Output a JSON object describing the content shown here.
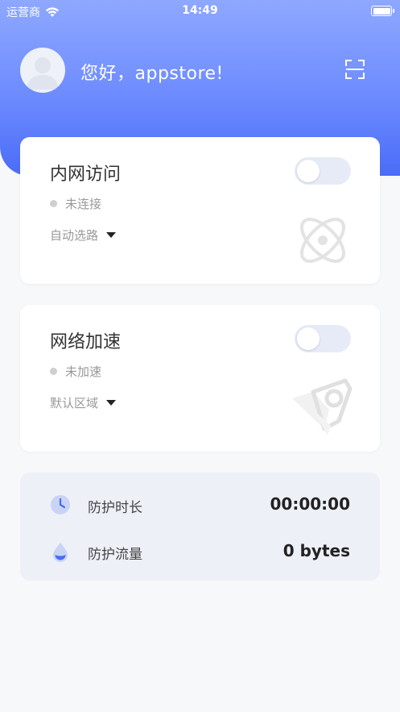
{
  "status_bar": {
    "carrier": "运营商",
    "time": "14:49"
  },
  "header": {
    "greeting": "您好，appstore!",
    "icons": {
      "avatar": "user-avatar",
      "scan": "scan-icon"
    }
  },
  "cards": [
    {
      "title": "内网访问",
      "status": "未连接",
      "select_value": "自动选路",
      "toggle_on": false,
      "icon": "atom-icon"
    },
    {
      "title": "网络加速",
      "status": "未加速",
      "select_value": "默认区域",
      "toggle_on": false,
      "icon": "rocket-icon"
    }
  ],
  "stats": [
    {
      "label": "防护时长",
      "value": "00:00:00",
      "icon": "clock-icon"
    },
    {
      "label": "防护流量",
      "value": "0 bytes",
      "icon": "water-drop-icon"
    }
  ],
  "colors": {
    "header_gradient_top": "#8ea8ff",
    "header_gradient_bottom": "#4a6cf7",
    "toggle_off": "#e6ebf7",
    "accent": "#4a6cf7",
    "status_dot": "#cfcfcf"
  }
}
